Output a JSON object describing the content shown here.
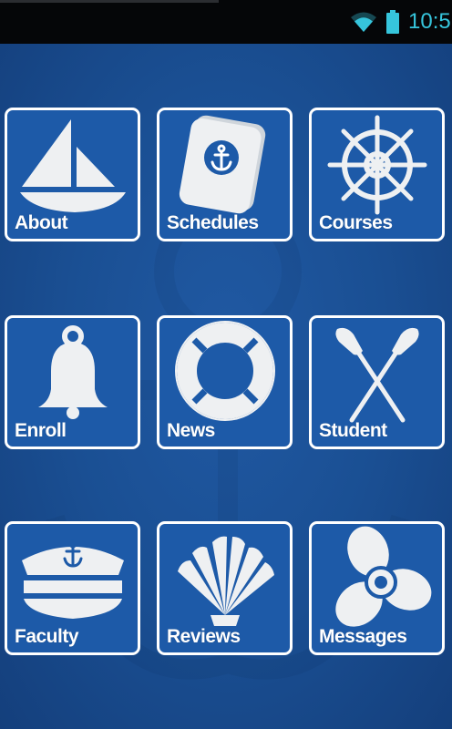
{
  "status_bar": {
    "time": "10:5",
    "wifi_icon": "wifi-icon",
    "battery_icon": "battery-icon",
    "accent_color": "#36c5dc"
  },
  "theme": {
    "background": "#1b4f92",
    "tile_border": "#ffffff"
  },
  "menu": {
    "tiles": [
      {
        "label": "About",
        "icon": "sailboat-icon"
      },
      {
        "label": "Schedules",
        "icon": "passport-anchor-icon"
      },
      {
        "label": "Courses",
        "icon": "ship-wheel-icon"
      },
      {
        "label": "Enroll",
        "icon": "bell-icon"
      },
      {
        "label": "News",
        "icon": "life-ring-icon"
      },
      {
        "label": "Student",
        "icon": "crossed-oars-icon"
      },
      {
        "label": "Faculty",
        "icon": "captain-hat-icon"
      },
      {
        "label": "Reviews",
        "icon": "seashell-icon"
      },
      {
        "label": "Messages",
        "icon": "propeller-icon"
      }
    ]
  }
}
